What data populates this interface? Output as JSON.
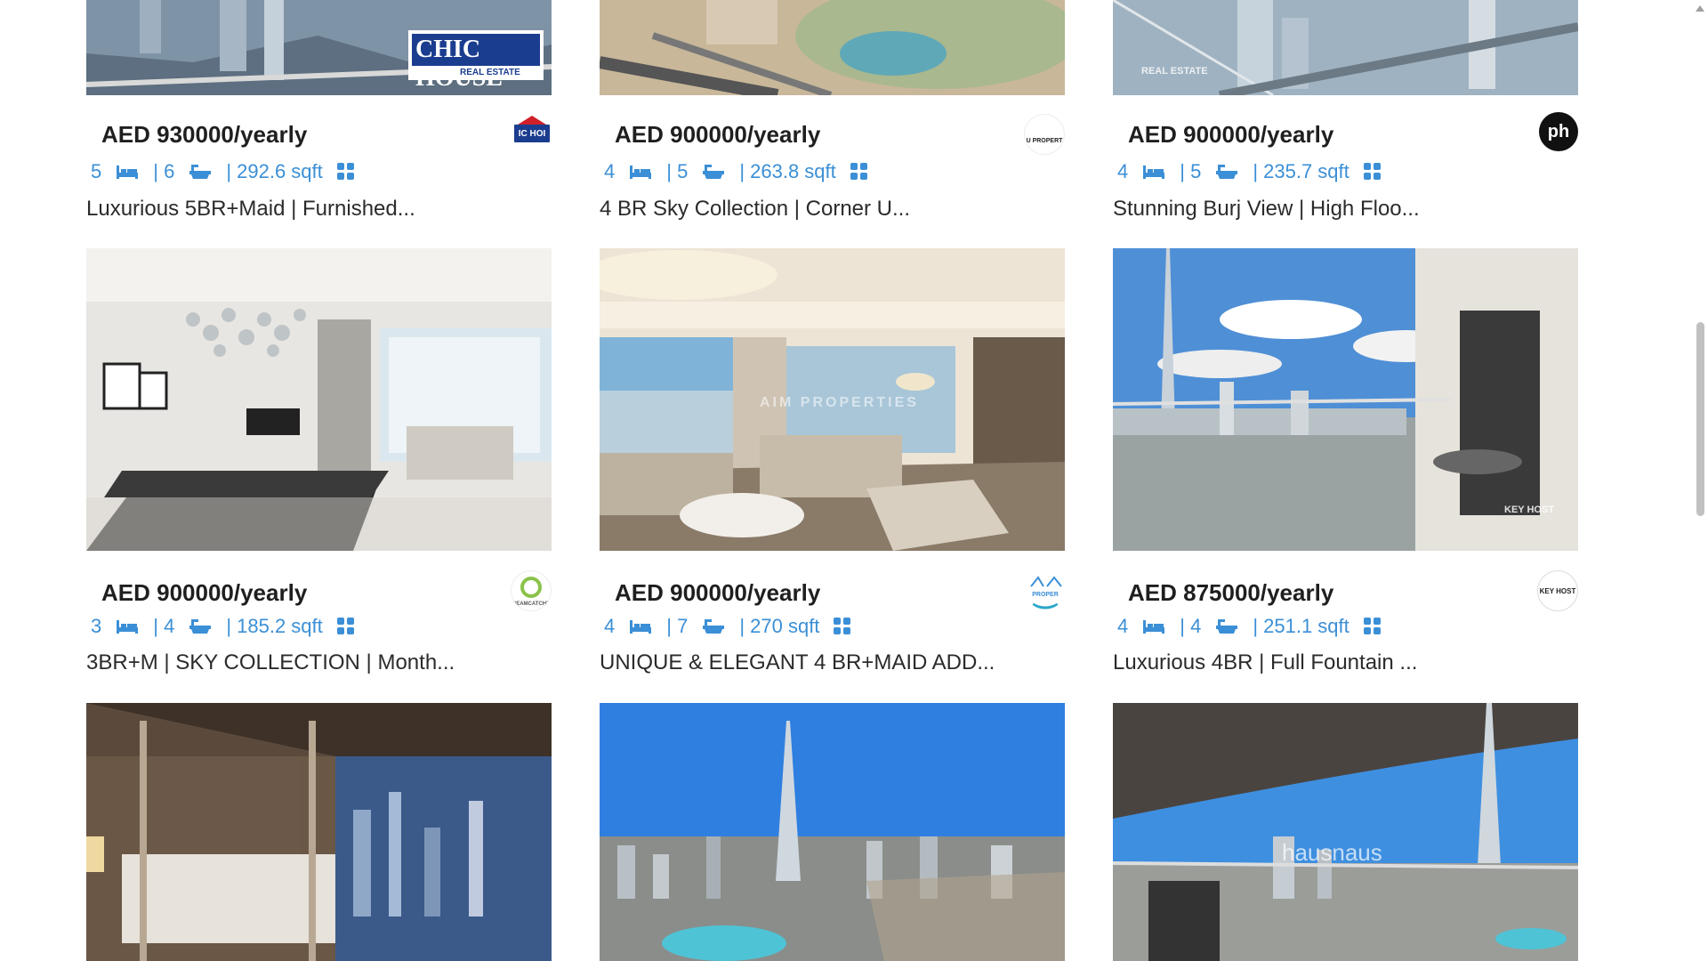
{
  "listings": [
    {
      "price": "AED 930000/yearly",
      "beds": "5",
      "baths": "| 6",
      "area": "| 292.6 sqft",
      "title": "Luxurious 5BR+Maid | Furnished...",
      "logo_text": "IC HOI",
      "image_watermark": "CHIC HOUSE",
      "watermark_sub": "REAL ESTATE"
    },
    {
      "price": "AED 900000/yearly",
      "beds": "4",
      "baths": "| 5",
      "area": "| 263.8 sqft",
      "title": "4 BR Sky Collection | Corner U...",
      "logo_text": "U PROPERT",
      "image_watermark": "",
      "watermark_sub": ""
    },
    {
      "price": "AED 900000/yearly",
      "beds": "4",
      "baths": "| 5",
      "area": "| 235.7 sqft",
      "title": "Stunning Burj View | High Floo...",
      "logo_text": "ph",
      "image_watermark": "",
      "watermark_sub": "REAL ESTATE"
    },
    {
      "price": "AED 900000/yearly",
      "beds": "3",
      "baths": "| 4",
      "area": "| 185.2 sqft",
      "title": "3BR+M | SKY COLLECTION | Month...",
      "logo_text": "REAMCATCHE",
      "image_watermark": "",
      "watermark_sub": ""
    },
    {
      "price": "AED 900000/yearly",
      "beds": "4",
      "baths": "| 7",
      "area": "| 270 sqft",
      "title": "UNIQUE & ELEGANT 4 BR+MAID ADD...",
      "logo_text": "PROPER",
      "image_watermark": "AIM PROPERTIES",
      "watermark_sub": ""
    },
    {
      "price": "AED 875000/yearly",
      "beds": "4",
      "baths": "| 4",
      "area": "| 251.1 sqft",
      "title": "Luxurious 4BR | Full Fountain ...",
      "logo_text": "KEY HOST",
      "image_watermark": "KEY HOST",
      "watermark_sub": ""
    },
    {
      "price": "",
      "beds": "",
      "baths": "",
      "area": "",
      "title": "",
      "logo_text": "",
      "image_watermark": "",
      "watermark_sub": ""
    },
    {
      "price": "",
      "beds": "",
      "baths": "",
      "area": "",
      "title": "",
      "logo_text": "",
      "image_watermark": "",
      "watermark_sub": ""
    },
    {
      "price": "",
      "beds": "",
      "baths": "",
      "area": "",
      "title": "",
      "logo_text": "hausnaus",
      "image_watermark": "hausnaus",
      "watermark_sub": ""
    }
  ],
  "icons": {
    "beds": "bed-icon",
    "baths": "bath-icon",
    "more": "grid-icon"
  },
  "colors": {
    "accent": "#3b8fd6",
    "text": "#1f1f1f",
    "background": "#ffffff"
  }
}
